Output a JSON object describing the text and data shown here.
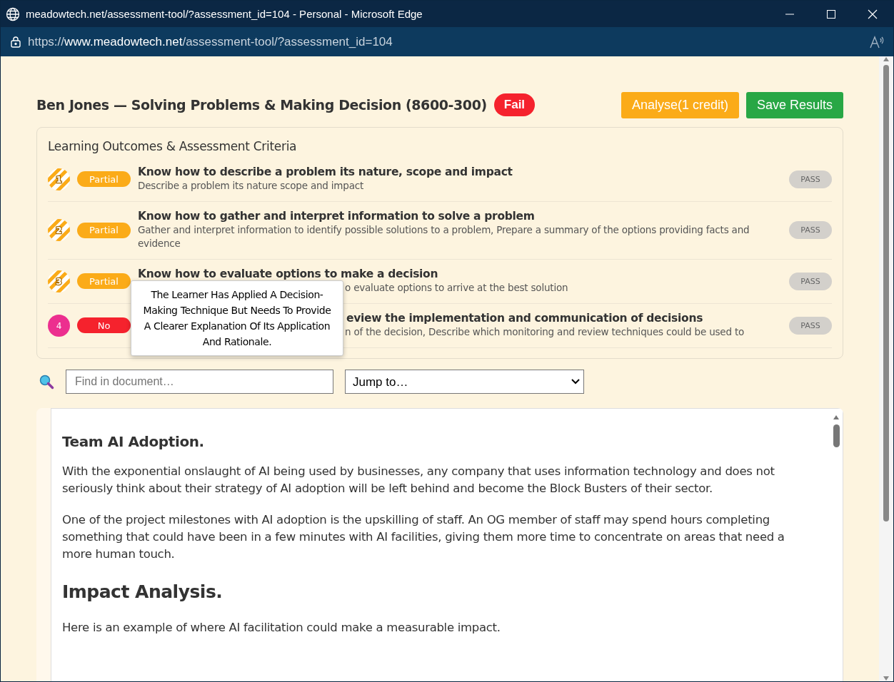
{
  "window": {
    "title": "meadowtech.net/assessment-tool/?assessment_id=104 - Personal - Microsoft Edge",
    "url_scheme": "https://",
    "url_host": "www.meadowtech.net",
    "url_path": "/assessment-tool/?assessment_id=104"
  },
  "header": {
    "title": "Ben Jones — Solving Problems & Making Decision (8600-300)",
    "result": "Fail",
    "buttons": [
      {
        "label": "Analyse(1 credit)",
        "kind": "warning"
      },
      {
        "label": "Save Results",
        "kind": "success"
      }
    ]
  },
  "outcomes": {
    "heading": "Learning Outcomes & Assessment Criteria",
    "items": [
      {
        "number": "1",
        "kind": "partial",
        "badge": "Partial",
        "title": "Know how to describe a problem its nature, scope and impact",
        "criteria": "Describe a problem its nature scope and impact",
        "title_covered": false,
        "criteria_covered": false,
        "pass": {
          "label": "PASS",
          "on": false
        }
      },
      {
        "number": "2",
        "kind": "partial",
        "badge": "Partial",
        "title": "Know how to gather and interpret information to solve a problem",
        "criteria": "Gather and interpret information to identify possible solutions to a problem, Prepare a summary of the options providing facts and evidence",
        "title_covered": false,
        "criteria_covered": false,
        "pass": {
          "label": "PASS",
          "on": false
        }
      },
      {
        "number": "3",
        "kind": "partial",
        "badge": "Partial",
        "title": "Know how to evaluate options to make a decision",
        "criteria": "o evaluate options to arrive at the best solution",
        "title_covered": false,
        "criteria_covered": true,
        "pass": {
          "label": "PASS",
          "on": false
        }
      },
      {
        "number": "4",
        "kind": "no",
        "badge": "No",
        "title": "eview the implementation and communication of decisions",
        "criteria": "n of the decision, Describe which monitoring and review techniques could be used to",
        "title_covered": true,
        "criteria_covered": true,
        "pass": {
          "label": "PASS",
          "on": false
        }
      }
    ],
    "tooltip": "The Learner Has Applied A Decision-Making Technique But Needs To Provide A Clearer Explanation Of Its Application And Rationale."
  },
  "search": {
    "placeholder": "Find in document…"
  },
  "jump": {
    "value": "Jump to…"
  },
  "document": [
    {
      "kind": "heading",
      "text": "Team AI Adoption."
    },
    {
      "kind": "paragraph",
      "text": "With the exponential onslaught of AI being used by businesses, any company that uses information technology and does not seriously think about their strategy of AI adoption will be left behind and become the Block Busters of their sector."
    },
    {
      "kind": "paragraph",
      "text": "One of the project milestones with AI adoption is the upskilling of staff. An OG member of staff may spend hours completing something that could have been in a few minutes with AI facilities, giving them more time to concentrate on areas that need a more human touch."
    },
    {
      "kind": "title",
      "text": "Impact Analysis."
    },
    {
      "kind": "paragraph",
      "text": "Here is an example of where AI facilitation could make a measurable impact."
    }
  ]
}
